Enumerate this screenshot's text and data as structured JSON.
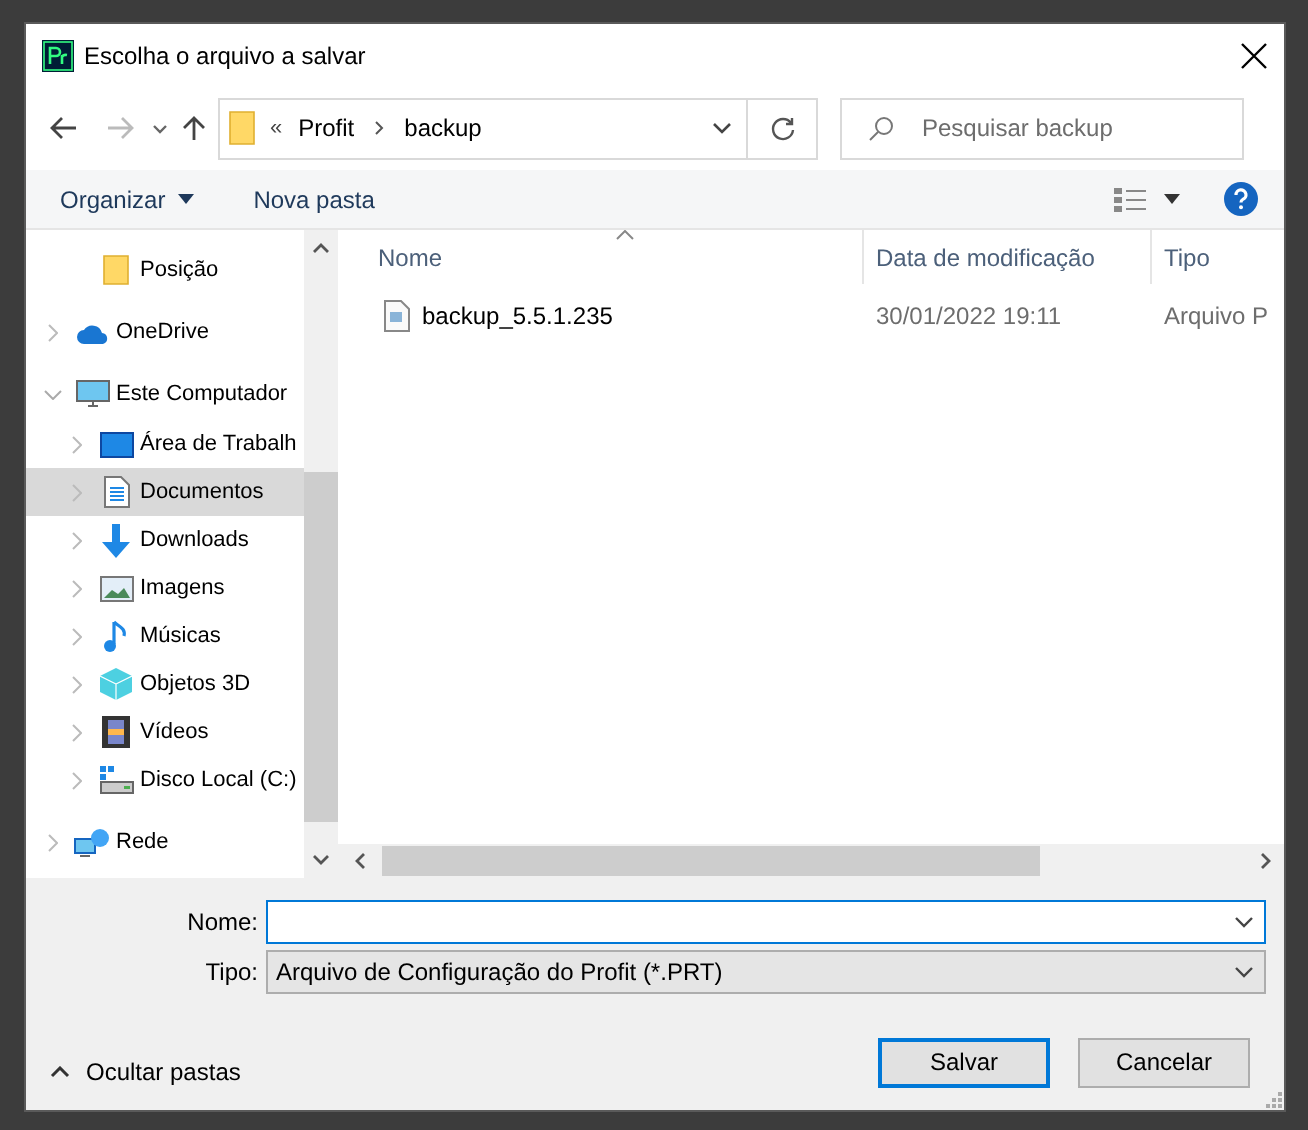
{
  "window": {
    "title": "Escolha o arquivo a salvar"
  },
  "address": {
    "overflow": "«",
    "segments": [
      "Profit",
      "backup"
    ]
  },
  "search": {
    "placeholder": "Pesquisar backup"
  },
  "toolbar": {
    "buttons": [
      "Organizar",
      "Nova pasta"
    ]
  },
  "sidebar": {
    "items": [
      {
        "label": "Posição",
        "kind": "folder",
        "selected": false
      },
      {
        "label": "OneDrive",
        "kind": "cloud",
        "expanded": false,
        "selected": false
      },
      {
        "label": "Este Computador",
        "kind": "computer",
        "expanded": true,
        "selected": false,
        "children": [
          {
            "label": "Área de Trabalh",
            "kind": "desktop",
            "expanded": false,
            "selected": false
          },
          {
            "label": "Documentos",
            "kind": "documents",
            "expanded": false,
            "selected": true
          },
          {
            "label": "Downloads",
            "kind": "download",
            "expanded": false,
            "selected": false
          },
          {
            "label": "Imagens",
            "kind": "pictures",
            "expanded": false,
            "selected": false
          },
          {
            "label": "Músicas",
            "kind": "music",
            "expanded": false,
            "selected": false
          },
          {
            "label": "Objetos 3D",
            "kind": "cube",
            "expanded": false,
            "selected": false
          },
          {
            "label": "Vídeos",
            "kind": "film",
            "expanded": false,
            "selected": false
          },
          {
            "label": "Disco Local (C:)",
            "kind": "drive",
            "expanded": false,
            "selected": false
          }
        ]
      },
      {
        "label": "Rede",
        "kind": "network",
        "expanded": false,
        "selected": false
      }
    ]
  },
  "file_list": {
    "columns": [
      "Nome",
      "Data de modificação",
      "Tipo"
    ],
    "rows": [
      {
        "name": "backup_5.5.1.235",
        "modified": "30/01/2022 19:11",
        "type": "Arquivo P"
      }
    ]
  },
  "form": {
    "name_label": "Nome:",
    "type_label": "Tipo:",
    "type_value": "Arquivo de Configuração do Profit (*.PRT)"
  },
  "hide_folders": "Ocultar pastas",
  "buttons": [
    {
      "label": "Salvar",
      "default": true
    },
    {
      "label": "Cancelar",
      "default": false
    }
  ]
}
